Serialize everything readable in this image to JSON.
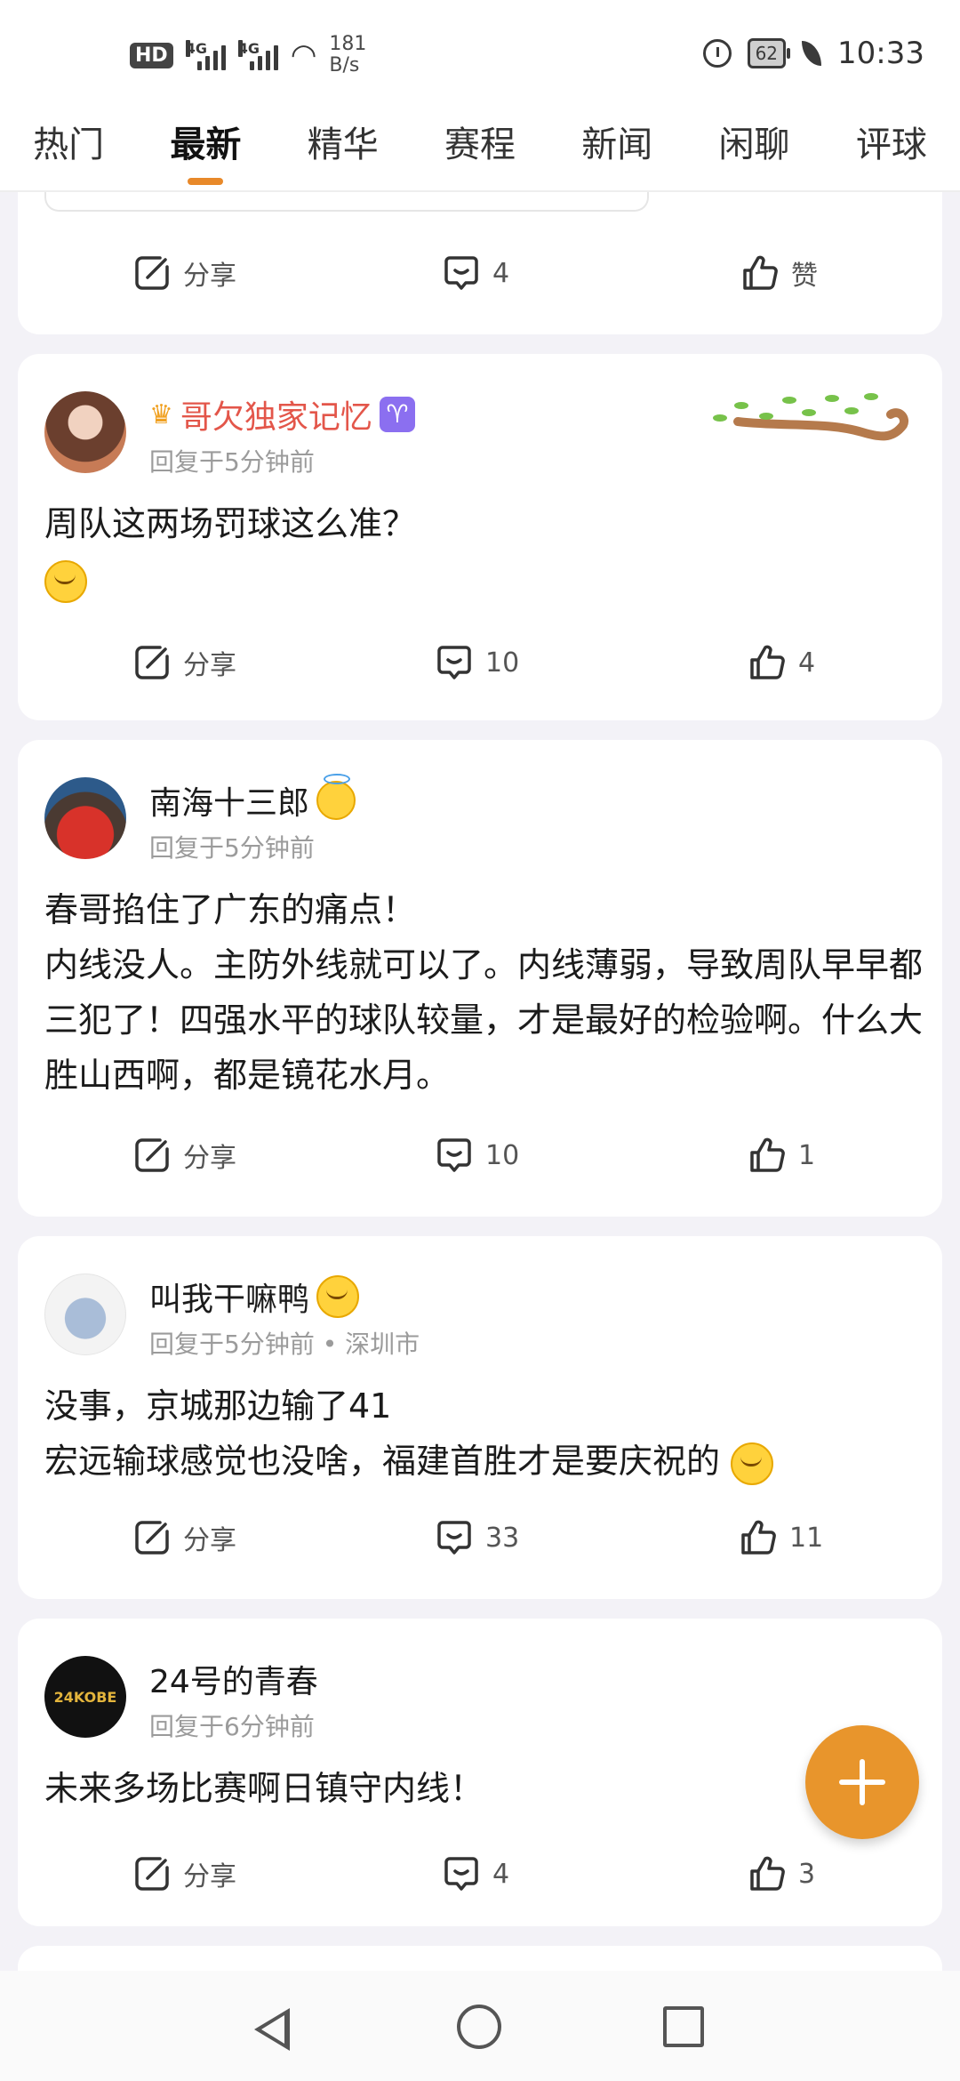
{
  "status_bar": {
    "hd": "HD",
    "sim1": "4G",
    "sim2": "4G",
    "speed_value": "181",
    "speed_unit": "B/s",
    "battery": "62",
    "time": "10:33"
  },
  "tabs": [
    {
      "label": "热门"
    },
    {
      "label": "最新",
      "active": true
    },
    {
      "label": "精华"
    },
    {
      "label": "赛程"
    },
    {
      "label": "新闻"
    },
    {
      "label": "闲聊"
    },
    {
      "label": "评球"
    }
  ],
  "posts": [
    {
      "share": "分享",
      "comments": "4",
      "likes": "赞"
    },
    {
      "username": "哥欠独家记忆",
      "meta": "回复于5分钟前",
      "content_lines": [
        "周队这两场罚球这么准？"
      ],
      "share": "分享",
      "comments": "10",
      "likes": "4"
    },
    {
      "username": "南海十三郎",
      "meta": "回复于5分钟前",
      "content_lines": [
        "春哥掐住了广东的痛点！",
        "内线没人。主防外线就可以了。内线薄弱，导致周队早早都三犯了！四强水平的球队较量，才是最好的检验啊。什么大胜山西啊，都是镜花水月。"
      ],
      "share": "分享",
      "comments": "10",
      "likes": "1"
    },
    {
      "username": "叫我干嘛鸭",
      "meta": "回复于5分钟前 • 深圳市",
      "content_lines": [
        "没事，京城那边输了41",
        "宏远输球感觉也没啥，福建首胜才是要庆祝的"
      ],
      "share": "分享",
      "comments": "33",
      "likes": "11"
    },
    {
      "username": "24号的青春",
      "avatar_text": "24KOBE",
      "meta": "回复于6分钟前",
      "content_lines": [
        "未来多场比赛啊日镇守内线！"
      ],
      "share": "分享",
      "comments": "4",
      "likes": "3"
    }
  ]
}
